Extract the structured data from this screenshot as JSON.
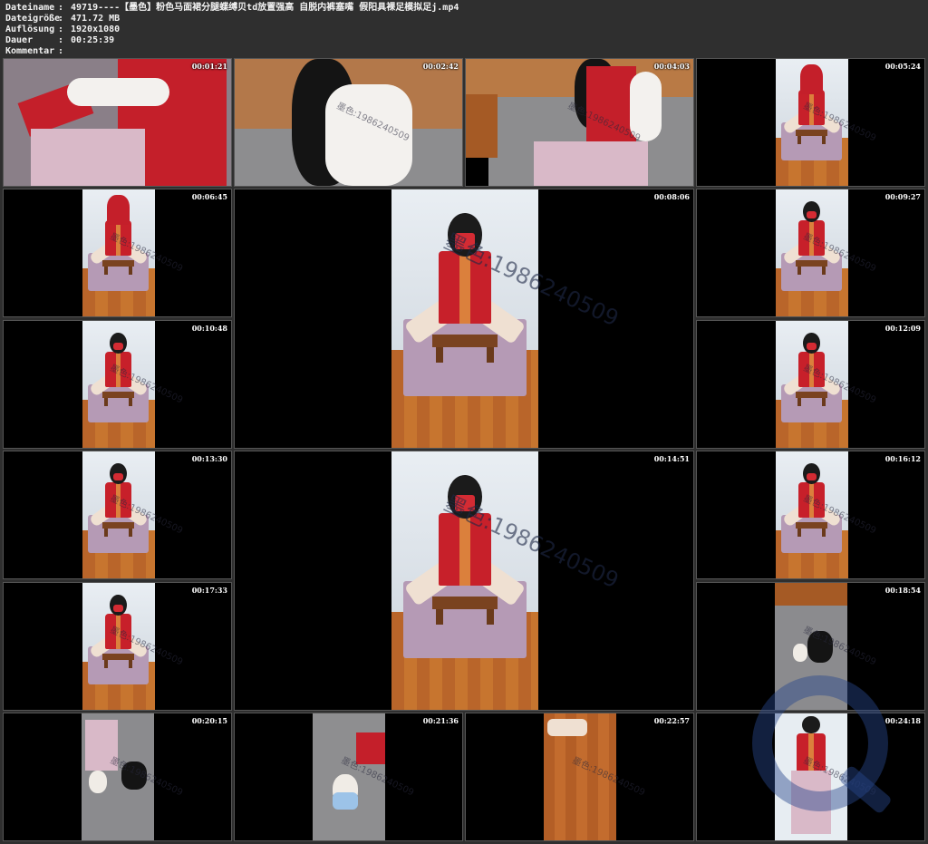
{
  "meta": [
    {
      "label": "Dateiname",
      "sep": ":",
      "value": "49719----【墨色】粉色马面裙分腿蝶缚贝td放置强高 自脱内裤塞嘴 假阳具裸足模拟足j.mp4"
    },
    {
      "label": "Dateigröße",
      "sep": ":",
      "value": "471.72 MB"
    },
    {
      "label": "Auflösung",
      "sep": ":",
      "value": "1920x1080"
    },
    {
      "label": "Dauer",
      "sep": ":",
      "value": "00:25:39"
    },
    {
      "label": "Kommentar",
      "sep": ":",
      "value": ""
    }
  ],
  "watermark": "墨色:1986240509",
  "thumbs": [
    {
      "ts": "00:01:21",
      "kind": "close-hands"
    },
    {
      "ts": "00:02:42",
      "kind": "close-sleeve"
    },
    {
      "ts": "00:04:03",
      "kind": "bed-sitting"
    },
    {
      "ts": "00:05:24",
      "kind": "hood-chair"
    },
    {
      "ts": "00:06:45",
      "kind": "hood-chair"
    },
    {
      "ts": "00:08:06",
      "kind": "chair-large"
    },
    {
      "ts": "00:09:27",
      "kind": "chair"
    },
    {
      "ts": "00:10:48",
      "kind": "chair"
    },
    {
      "ts": "00:12:09",
      "kind": "chair"
    },
    {
      "ts": "00:13:30",
      "kind": "chair"
    },
    {
      "ts": "00:14:51",
      "kind": "chair-large"
    },
    {
      "ts": "00:16:12",
      "kind": "chair"
    },
    {
      "ts": "00:17:33",
      "kind": "chair"
    },
    {
      "ts": "00:18:54",
      "kind": "bed-floor"
    },
    {
      "ts": "00:20:15",
      "kind": "bed-lying"
    },
    {
      "ts": "00:21:36",
      "kind": "cat"
    },
    {
      "ts": "00:22:57",
      "kind": "floor-feet"
    },
    {
      "ts": "00:24:18",
      "kind": "standing"
    }
  ]
}
